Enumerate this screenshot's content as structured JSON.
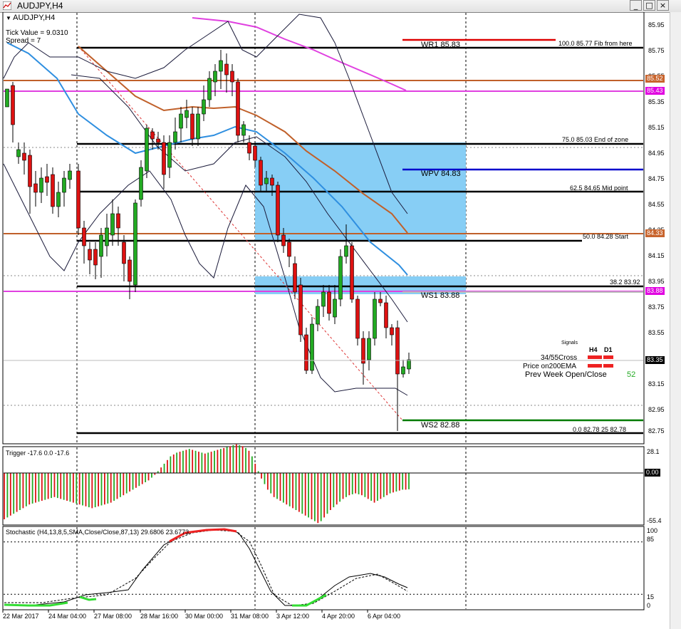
{
  "window": {
    "title": "AUDJPY,H4"
  },
  "info": {
    "symbol": "AUDJPY,H4",
    "tick_value": "Tick Value = 9.0310",
    "spread": "Spread = 7"
  },
  "price_scale": [
    "85.95",
    "85.75",
    "85.55",
    "85.35",
    "85.15",
    "84.95",
    "84.75",
    "84.55",
    "84.35",
    "84.15",
    "83.95",
    "83.75",
    "83.55",
    "83.35",
    "83.15",
    "82.95",
    "82.75"
  ],
  "price_badges": [
    {
      "text": "85.52",
      "color": "#c8642d"
    },
    {
      "text": "85.43",
      "color": "#e000e0"
    },
    {
      "text": "84.33",
      "color": "#c8642d"
    },
    {
      "text": "83.88",
      "color": "#e000e0"
    },
    {
      "text": "83.35",
      "color": "#000000"
    }
  ],
  "pivots": {
    "wr1": "WR1   85.83",
    "wpv": "WPV   84.83",
    "ws1": "WS1   83.88",
    "ws2": "WS2   82.88"
  },
  "fib": {
    "f100": "100.0   85.77     Fib from here",
    "f75": "75.0     85.03      End of zone",
    "f625": "62.5     84.65      Mid point",
    "f50": "50.0     84.28      Start",
    "f382": "38.2  83.92",
    "f0": "0.0    82.78     25     82.78"
  },
  "signals": {
    "header": "Signals",
    "col_h4": "H4",
    "col_d1": "D1",
    "row1": "34/55Cross",
    "row2": "Price on200EMA",
    "row3": "Prev Week Open/Close",
    "row3_value": "52"
  },
  "trigger": {
    "title": "Trigger -17.6 0.0 -17.6",
    "scale_top": "28.1",
    "scale_zero": "0.00",
    "scale_bottom": "-55.4"
  },
  "stochastic": {
    "title": "Stochastic (H4,13,8,5,SMA,Close/Close,87,13) 29.6806 23.6773",
    "scale": [
      "100",
      "85",
      "15",
      "0"
    ]
  },
  "time_axis": [
    "22 Mar 2017",
    "24 Mar 04:00",
    "27 Mar 08:00",
    "28 Mar 16:00",
    "30 Mar 00:00",
    "31 Mar 08:00",
    "3 Apr 12:00",
    "4 Apr 20:00",
    "6 Apr 04:00"
  ],
  "colors": {
    "bull": "#22aa22",
    "bear": "#dd1111",
    "zone": "#87cef5",
    "band": "#1a1a3a",
    "ma_blue": "#2f8fe0",
    "ma_brown": "#c0602a",
    "ma_magenta": "#e040e0",
    "pivot_red": "#dd0000",
    "pivot_blue": "#0000cc",
    "pivot_green": "#007a00"
  }
}
